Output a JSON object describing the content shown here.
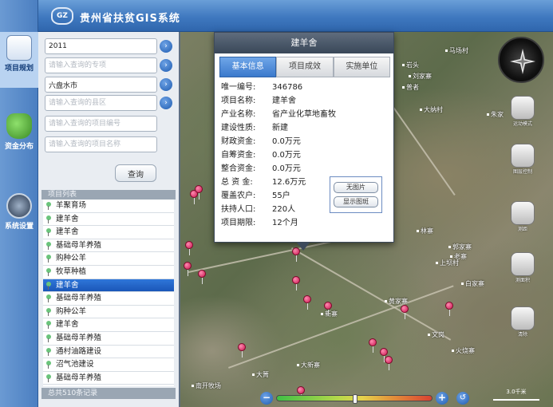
{
  "app": {
    "logo_text": "GZ",
    "title": "贵州省扶贫GIS系统"
  },
  "nav": {
    "items": [
      {
        "label": "项目规划",
        "icon": "project-plan-icon"
      },
      {
        "label": "资金分布",
        "icon": "money-bag-icon"
      },
      {
        "label": "系统设置",
        "icon": "settings-gear-icon"
      }
    ]
  },
  "filters": {
    "year": {
      "value": "2011",
      "placeholder": ""
    },
    "project_type": {
      "value": "",
      "placeholder": "请输入查询的专项"
    },
    "city": {
      "value": "六盘水市",
      "placeholder": ""
    },
    "county": {
      "value": "",
      "placeholder": "请输入查询的县区"
    },
    "project_no": {
      "value": "",
      "placeholder": "请输入查询的项目编号"
    },
    "project_name": {
      "value": "",
      "placeholder": "请输入查询的项目名称"
    },
    "query_label": "查询"
  },
  "project_list": {
    "header": "项目列表",
    "items": [
      "羊聚育场",
      "建羊舍",
      "建羊舍",
      "基础母羊养殖",
      "购种公羊",
      "牧草种植",
      "建羊舍",
      "基础母羊养殖",
      "购种公羊",
      "建羊舍",
      "基础母羊养殖",
      "通村油路建设",
      "沼气池建设",
      "基础母羊养殖"
    ],
    "selected_index": 6,
    "footer": "总共510条记录"
  },
  "popup": {
    "title": "建羊舍",
    "tabs": [
      "基本信息",
      "项目成效",
      "实施单位"
    ],
    "active_tab": 0,
    "fields": [
      {
        "key": "唯一编号:",
        "value": "346786"
      },
      {
        "key": "项目名称:",
        "value": "建羊舍"
      },
      {
        "key": "产业名称:",
        "value": "省产业化草地畜牧"
      },
      {
        "key": "建设性质:",
        "value": "新建"
      },
      {
        "key": "财政资金:",
        "value": "0.0万元"
      },
      {
        "key": "自筹资金:",
        "value": "0.0万元"
      },
      {
        "key": "整合资金:",
        "value": "0.0万元"
      },
      {
        "key": "总 资 金:",
        "value": "12.6万元"
      },
      {
        "key": "覆盖农户:",
        "value": "55户"
      },
      {
        "key": "扶持人口:",
        "value": "220人"
      },
      {
        "key": "项目期限:",
        "value": "12个月"
      }
    ],
    "no_image_label": "无图片",
    "show_photo_label": "显示图斑"
  },
  "map": {
    "places": [
      "马场村",
      "岩头",
      "刘家寨",
      "普者",
      "大纳村",
      "朱家",
      "林寨",
      "郭家寨",
      "老寨",
      "上坝村",
      "白家寨",
      "黄家寨",
      "文岗",
      "火烧寨",
      "大箐",
      "南开牧场",
      "大新寨",
      "新寨"
    ],
    "tools": [
      {
        "label": "运动模式",
        "icon": "car-icon"
      },
      {
        "label": "图层控制",
        "icon": "layers-icon"
      },
      {
        "label": "测距",
        "icon": "ruler-icon"
      },
      {
        "label": "测面积",
        "icon": "area-icon"
      },
      {
        "label": "清除",
        "icon": "eraser-icon"
      }
    ],
    "scale_label": "3.0千米",
    "zoom_level": 0.5
  },
  "colors": {
    "header": "#3f78bf",
    "selected_row": "#1a57b8",
    "marker": "#c8144e"
  }
}
